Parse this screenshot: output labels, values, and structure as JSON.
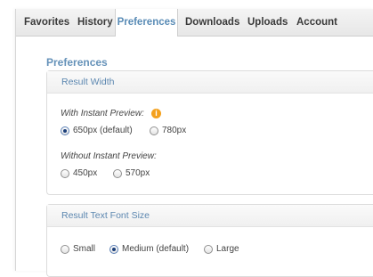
{
  "tabs": [
    {
      "label": "Favorites"
    },
    {
      "label": "History"
    },
    {
      "label": "Preferences"
    },
    {
      "label": "Downloads"
    },
    {
      "label": "Uploads"
    },
    {
      "label": "Account"
    }
  ],
  "active_tab": "Preferences",
  "page_title": "Preferences",
  "result_width": {
    "header": "Result Width",
    "with_preview": {
      "label": "With Instant Preview:",
      "info_glyph": "i",
      "options": [
        "650px  (default)",
        "780px"
      ],
      "selected": "650px  (default)"
    },
    "without_preview": {
      "label": "Without Instant Preview:",
      "options": [
        "450px",
        "570px"
      ],
      "selected": null
    }
  },
  "font_size": {
    "header": "Result Text Font Size",
    "options": [
      "Small",
      "Medium (default)",
      "Large"
    ],
    "selected": "Medium (default)"
  },
  "colors": {
    "accent": "#5a8cb6",
    "info_icon": "#f4a11e"
  }
}
